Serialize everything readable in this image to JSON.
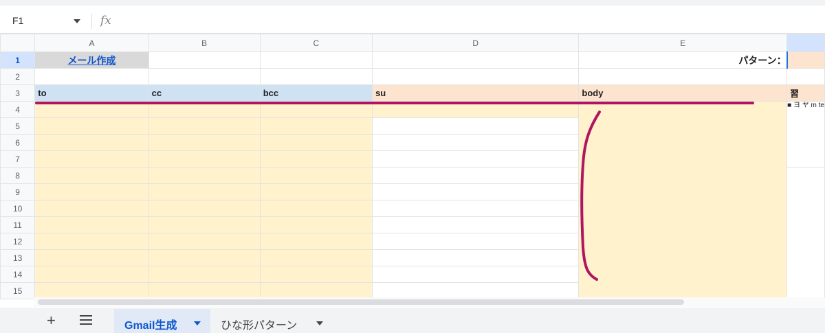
{
  "formula_bar": {
    "cell_ref": "F1",
    "fx_label": "fx"
  },
  "columns": [
    "A",
    "B",
    "C",
    "D",
    "E"
  ],
  "rows": [
    "1",
    "2",
    "3",
    "4",
    "5",
    "6",
    "7",
    "8",
    "9",
    "10",
    "11",
    "12",
    "13",
    "14",
    "15"
  ],
  "cells": {
    "A1": "メール作成",
    "E1": "パターン：",
    "A3": "to",
    "B3": "cc",
    "C3": "bcc",
    "D3": "su",
    "E3": "body",
    "F3_partial": "習",
    "F4_partial": "■ ヨ ヤ m te"
  },
  "colors": {
    "header_blue": "#cfe2f3",
    "header_peach": "#fde4cf",
    "cell_yellow": "#fff2cc",
    "annotation": "#b0165f",
    "active_tab": "#0b57d0"
  },
  "sheet_tabs": [
    {
      "label": "Gmail生成",
      "active": true
    },
    {
      "label": "ひな形パターン",
      "active": false
    }
  ],
  "icons": {
    "add_sheet": "+",
    "all_sheets": "menu-icon"
  }
}
